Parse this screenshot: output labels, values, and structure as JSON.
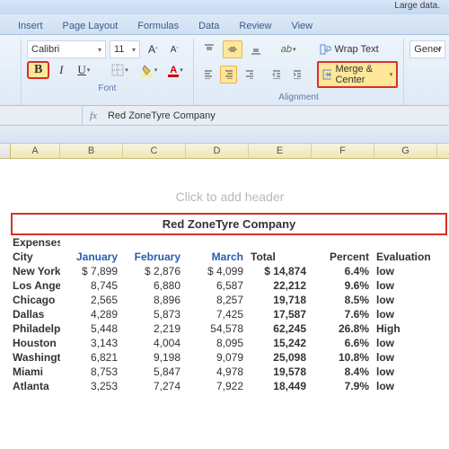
{
  "titlebar": "Large data.",
  "tabs": [
    "Insert",
    "Page Layout",
    "Formulas",
    "Data",
    "Review",
    "View"
  ],
  "font": {
    "group_label": "Font",
    "name": "Calibri",
    "size": "11",
    "bold": "B",
    "italic": "I",
    "underline": "U"
  },
  "alignment": {
    "group_label": "Alignment",
    "wrap": "Wrap Text",
    "merge": "Merge & Center"
  },
  "number": {
    "format": "Gener"
  },
  "formula": {
    "fx": "fx",
    "value": "Red ZoneTyre Company"
  },
  "columns": [
    "A",
    "B",
    "C",
    "D",
    "E",
    "F",
    "G"
  ],
  "sheet": {
    "header_placeholder": "Click to add header",
    "title": "Red ZoneTyre Company",
    "section": "Expenses",
    "headers": [
      "City",
      "January",
      "February",
      "March",
      "Total",
      "Percent",
      "Evaluation"
    ],
    "rows": [
      {
        "city": "New York (",
        "jan": "7,899",
        "janp": "$",
        "feb": "2,876",
        "febp": "$",
        "mar": "4,099",
        "marp": "$",
        "total": "14,874",
        "totp": "$",
        "pct": "6.4%",
        "eval": "low"
      },
      {
        "city": "Los Angele",
        "jan": "8,745",
        "feb": "6,880",
        "mar": "6,587",
        "total": "22,212",
        "pct": "9.6%",
        "eval": "low"
      },
      {
        "city": "Chicago",
        "jan": "2,565",
        "feb": "8,896",
        "mar": "8,257",
        "total": "19,718",
        "pct": "8.5%",
        "eval": "low"
      },
      {
        "city": "Dallas",
        "jan": "4,289",
        "feb": "5,873",
        "mar": "7,425",
        "total": "17,587",
        "pct": "7.6%",
        "eval": "low"
      },
      {
        "city": "Philadelph",
        "jan": "5,448",
        "feb": "2,219",
        "mar": "54,578",
        "total": "62,245",
        "pct": "26.8%",
        "eval": "High"
      },
      {
        "city": "Houston",
        "jan": "3,143",
        "feb": "4,004",
        "mar": "8,095",
        "total": "15,242",
        "pct": "6.6%",
        "eval": "low"
      },
      {
        "city": "Washingto",
        "jan": "6,821",
        "feb": "9,198",
        "mar": "9,079",
        "total": "25,098",
        "pct": "10.8%",
        "eval": "low"
      },
      {
        "city": "Miami",
        "jan": "8,753",
        "feb": "5,847",
        "mar": "4,978",
        "total": "19,578",
        "pct": "8.4%",
        "eval": "low"
      },
      {
        "city": "Atlanta",
        "jan": "3,253",
        "feb": "7,274",
        "mar": "7,922",
        "total": "18,449",
        "pct": "7.9%",
        "eval": "low"
      }
    ]
  }
}
